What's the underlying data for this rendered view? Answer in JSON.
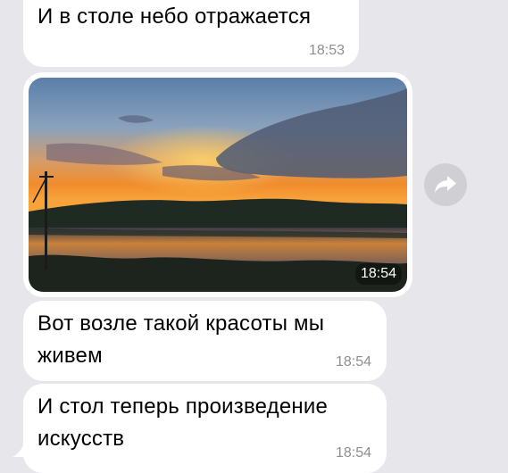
{
  "messages": [
    {
      "text": "И в столе небо отражается",
      "time": "18:53"
    },
    {
      "type": "photo",
      "time": "18:54"
    },
    {
      "text": "Вот возле такой красоты мы живем",
      "time": "18:54"
    },
    {
      "text": "И стол теперь произведение искусств",
      "time": "18:54"
    }
  ],
  "share_icon": "share-arrow-icon",
  "colors": {
    "background": "#e6e6eb",
    "bubble": "#ffffff",
    "timestamp": "#8e8e93",
    "share_button": "#cfcfd4"
  }
}
